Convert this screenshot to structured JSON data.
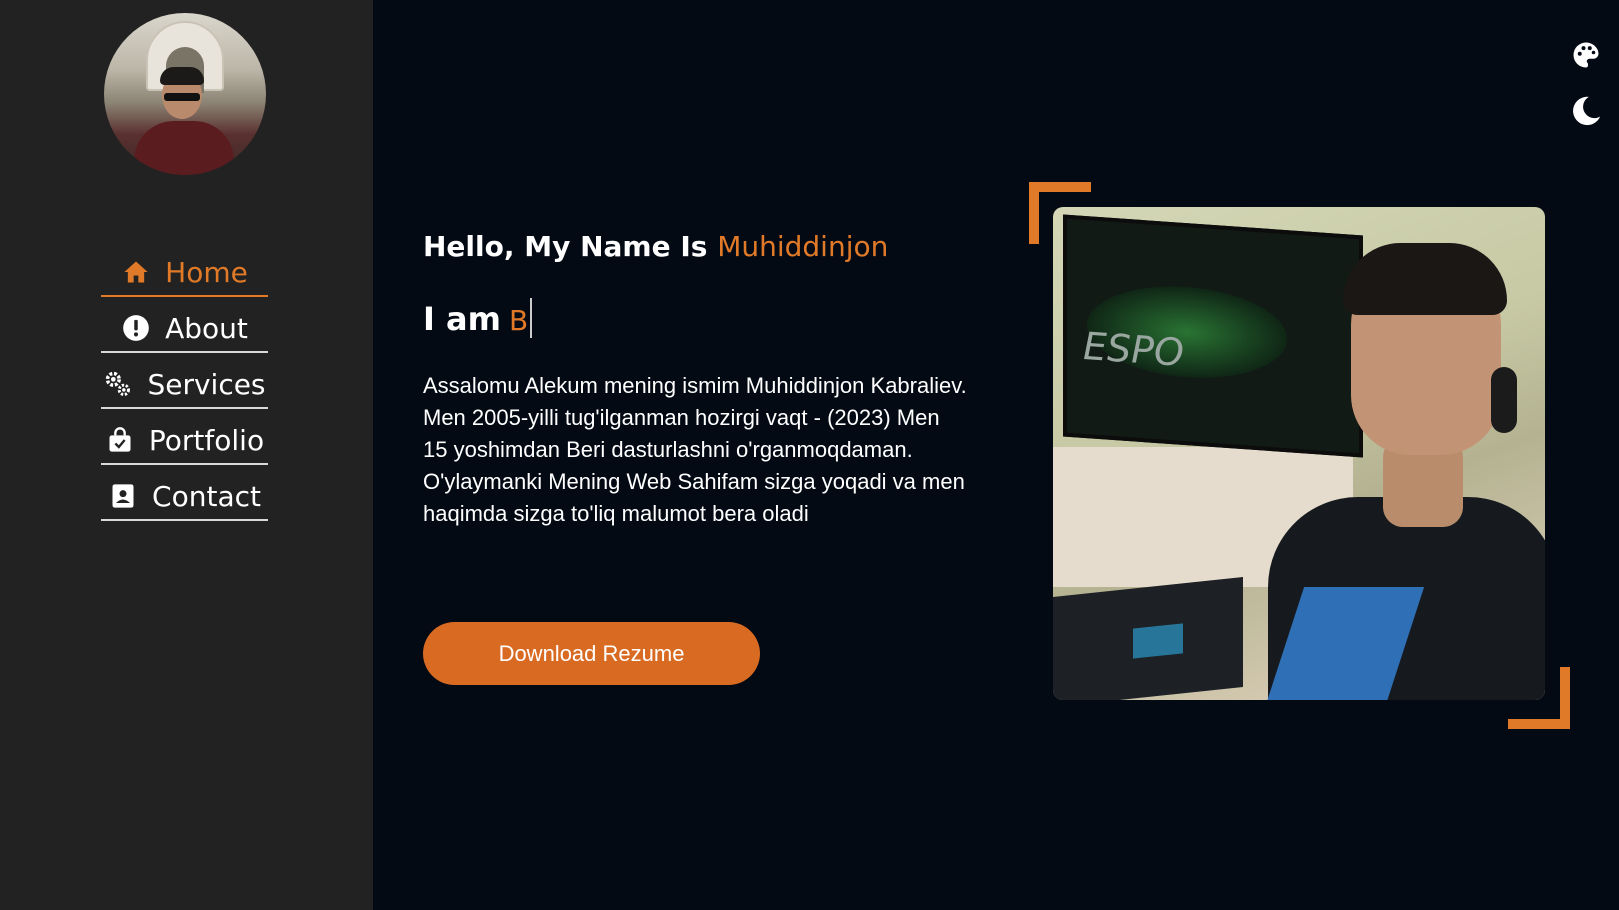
{
  "nav": {
    "items": [
      {
        "label": "Home",
        "icon": "home-icon",
        "active": true
      },
      {
        "label": "About",
        "icon": "exclamation-circle-icon",
        "active": false
      },
      {
        "label": "Services",
        "icon": "gears-icon",
        "active": false
      },
      {
        "label": "Portfolio",
        "icon": "shopping-bag-check-icon",
        "active": false
      },
      {
        "label": "Contact",
        "icon": "contact-card-icon",
        "active": false
      }
    ]
  },
  "top_icons": [
    "palette-icon",
    "moon-icon"
  ],
  "hero": {
    "greeting": "Hello, My Name Is",
    "name": "Muhiddinjon",
    "iam_prefix": "I am",
    "typed_text": "B",
    "description": "Assalomu Alekum mening ismim Muhiddinjon Kabraliev. Men 2005-yilli tug'ilganman hozirgi vaqt - (2023) Men 15 yoshimdan Beri dasturlashni o'rganmoqdaman. O'ylaymanki Mening Web Sahifam sizga yoqadi va men haqimda sizga to'liq malumot bera oladi",
    "button_label": "Download Rezume"
  },
  "colors": {
    "accent": "#e07a28",
    "sidebar_bg": "#222222",
    "page_bg": "#040a14",
    "button_bg": "#d86a22"
  }
}
